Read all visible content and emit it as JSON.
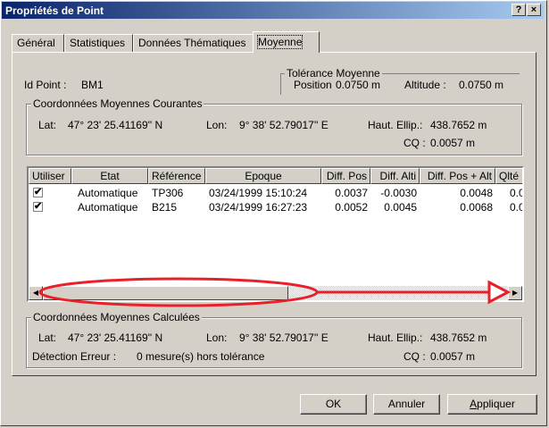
{
  "window": {
    "title": "Propriétés de Point",
    "help_label": "?",
    "close_label": "×"
  },
  "tabs": [
    {
      "label": "Général"
    },
    {
      "label": "Statistiques"
    },
    {
      "label": "Données Thématiques"
    },
    {
      "label": "Moyenne"
    }
  ],
  "point": {
    "id_label": "Id Point :",
    "id_value": "BM1"
  },
  "tolerance": {
    "legend": "Tolérance Moyenne",
    "position_label": "Position",
    "position_value": "0.0750 m",
    "altitude_label": "Altitude :",
    "altitude_value": "0.0750 m"
  },
  "current": {
    "legend": "Coordonnées Moyennes Courantes",
    "lat_label": "Lat:",
    "lat_value": "47° 23' 25.41169'' N",
    "lon_label": "Lon:",
    "lon_value": "9° 38' 52.79017'' E",
    "haut_label": "Haut. Ellip.:",
    "haut_value": "438.7652 m",
    "cq_label": "CQ :",
    "cq_value": "0.0057 m"
  },
  "table": {
    "columns": [
      "Utiliser",
      "Etat",
      "Référence",
      "Epoque",
      "Diff. Pos",
      "Diff. Alti",
      "Diff. Pos + Alt",
      "Qlté"
    ],
    "rows": [
      {
        "checked": "✔",
        "etat": "Automatique",
        "ref": "TP306",
        "epoque": "03/24/1999 15:10:24",
        "diff_pos": "0.0037",
        "diff_alti": "-0.0030",
        "diff_pos_alt": "0.0048",
        "qlte": "0.0"
      },
      {
        "checked": "✔",
        "etat": "Automatique",
        "ref": "B215",
        "epoque": "03/24/1999 16:27:23",
        "diff_pos": "0.0052",
        "diff_alti": "0.0045",
        "diff_pos_alt": "0.0068",
        "qlte": "0.0"
      }
    ]
  },
  "computed": {
    "legend": "Coordonnées Moyennes Calculées",
    "lat_label": "Lat:",
    "lat_value": "47° 23' 25.41169'' N",
    "lon_label": "Lon:",
    "lon_value": "9° 38' 52.79017'' E",
    "haut_label": "Haut. Ellip.:",
    "haut_value": "438.7652 m",
    "error_label": "Détection Erreur :",
    "error_value": "0 mesure(s) hors tolérance",
    "cq_label": "CQ :",
    "cq_value": "0.0057 m"
  },
  "buttons": {
    "ok": "OK",
    "cancel": "Annuler",
    "apply_first": "A",
    "apply_rest": "ppliquer"
  },
  "colors": {
    "annotation": "#e8202a",
    "title_bar": "#0a246a"
  }
}
